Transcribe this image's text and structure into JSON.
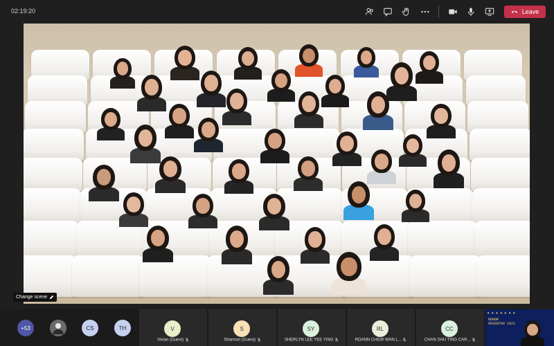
{
  "topbar": {
    "timer": "02:19:20",
    "leave_label": "Leave",
    "icons": [
      "people-icon",
      "chat-icon",
      "raise-hand-icon",
      "more-icon",
      "camera-icon",
      "mic-icon",
      "share-icon",
      "phone-icon"
    ]
  },
  "scene": {
    "change_scene_label": "Change scene"
  },
  "participants_strip": {
    "overflow_count": "+53",
    "avatars": [
      {
        "initials": "",
        "color": "#9a9a9a"
      },
      {
        "initials": "CS",
        "color": "#c6d1f0"
      },
      {
        "initials": "TH",
        "color": "#c6d1f0"
      }
    ],
    "tiles": [
      {
        "initials": "V",
        "name": "Vivian (Guest)",
        "color": "#e9edc9"
      },
      {
        "initials": "S",
        "name": "Shannon (Guest)",
        "color": "#f7e1b5"
      },
      {
        "initials": "SY",
        "name": "SHERLYN LEE YEE YING",
        "color": "#d8f0dc"
      },
      {
        "initials": "RL",
        "name": "ROANN CHEW WAN L...",
        "color": "#e9edd9"
      },
      {
        "initials": "CC",
        "name": "CHAN SHU TING CAR...",
        "color": "#d8f0dc"
      }
    ],
    "self_view_text": "NOHDR ORIENTAD 2022"
  },
  "colors": {
    "leave": "#c4314b",
    "overflow_badge": "#4e57a5"
  }
}
